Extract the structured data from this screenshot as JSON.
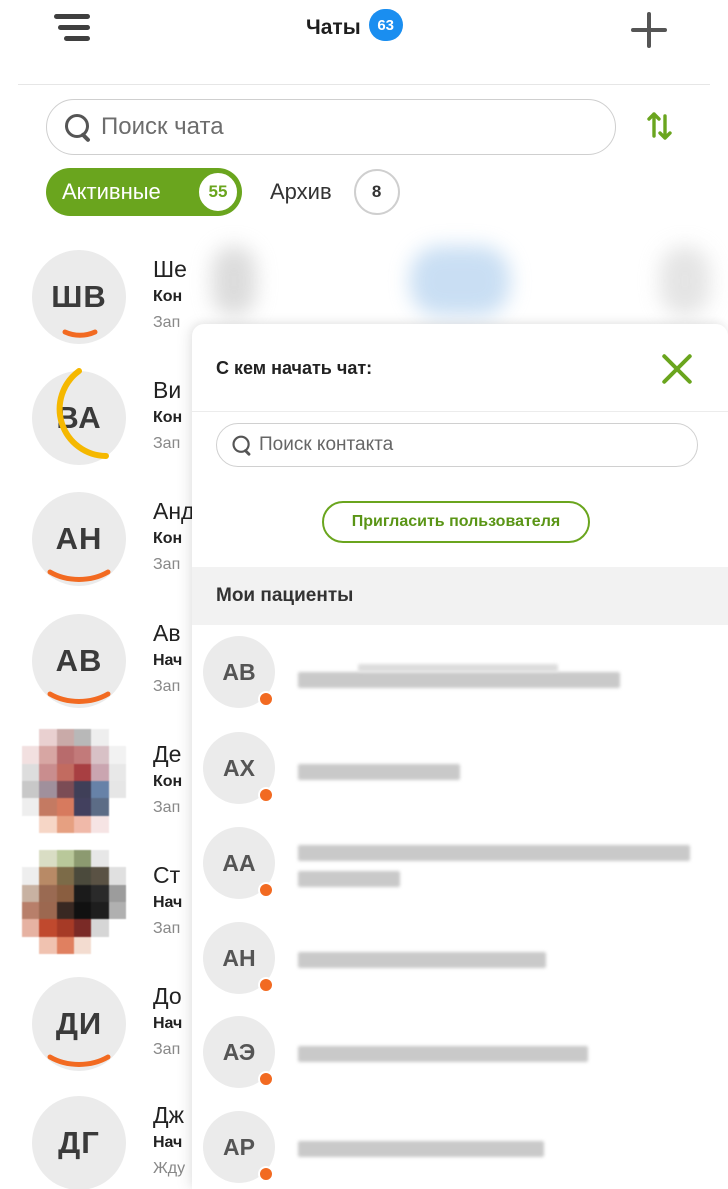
{
  "header": {
    "title": "Чаты",
    "badge": "63",
    "menu_icon": "hamburger-menu-icon",
    "add_icon": "plus-icon"
  },
  "search": {
    "placeholder": "Поиск чата"
  },
  "sort_icon": "sort-arrows-icon",
  "tabs": {
    "active": {
      "label": "Активные",
      "count": "55"
    },
    "archive": {
      "label": "Архив",
      "count": "8"
    }
  },
  "colors": {
    "accent_green": "#6aa51e",
    "badge_blue": "#1a8ef0",
    "ring_orange": "#f26a21",
    "ring_yellow": "#f5b800"
  },
  "chats": [
    {
      "initials": "ШВ",
      "name": "Ше",
      "status": "Кон",
      "sub": "Зап",
      "ring": "orange"
    },
    {
      "initials": "ВА",
      "name": "Ви",
      "status": "Кон",
      "sub": "Зап",
      "ring": "yellow"
    },
    {
      "initials": "АН",
      "name": "Анд",
      "status": "Кон",
      "sub": "Зап",
      "ring": "orange"
    },
    {
      "initials": "АВ",
      "name": "Ав",
      "status": "Нач",
      "sub": "Зап",
      "ring": "orange"
    },
    {
      "initials": "",
      "name": "Де",
      "status": "Кон",
      "sub": "Зап",
      "ring": "none"
    },
    {
      "initials": "",
      "name": "Ст",
      "status": "Нач",
      "sub": "Зап",
      "ring": "none"
    },
    {
      "initials": "ДИ",
      "name": "До",
      "status": "Нач",
      "sub": "Зап",
      "ring": "orange"
    },
    {
      "initials": "ДГ",
      "name": "Дж",
      "status": "Нач",
      "sub": "Жду",
      "ring": "none"
    }
  ],
  "panel": {
    "title": "С кем начать чат:",
    "close_icon": "close-x-icon",
    "contact_search_placeholder": "Поиск контакта",
    "invite_label": "Пригласить пользователя",
    "section_title": "Мои пациенты",
    "patients": [
      {
        "initials": "АВ"
      },
      {
        "initials": "АХ"
      },
      {
        "initials": "АА"
      },
      {
        "initials": "АН"
      },
      {
        "initials": "АЭ"
      },
      {
        "initials": "АР"
      }
    ]
  }
}
